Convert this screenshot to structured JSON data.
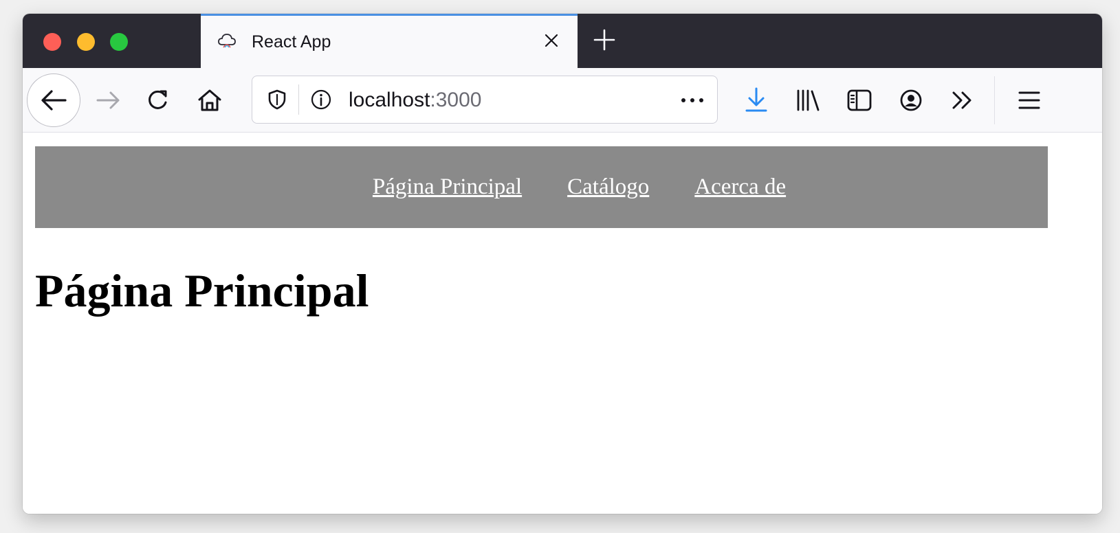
{
  "window": {
    "tab": {
      "title": "React App",
      "favicon": "rainbow-cloud-icon"
    },
    "colors": {
      "tab_accent": "#4a90e2",
      "tabstrip": "#2b2a33",
      "download_accent": "#2a8bf2"
    }
  },
  "toolbar": {
    "url": {
      "host": "localhost",
      "port": ":3000"
    },
    "icons": [
      "back-arrow-icon",
      "forward-arrow-icon",
      "reload-icon",
      "home-icon",
      "shield-icon",
      "info-icon",
      "more-dots-icon",
      "download-icon",
      "library-icon",
      "sidebar-icon",
      "account-icon",
      "overflow-chevrons-icon",
      "hamburger-menu-icon"
    ]
  },
  "page": {
    "nav": {
      "links": [
        {
          "label": "Página Principal"
        },
        {
          "label": "Catálogo"
        },
        {
          "label": "Acerca de"
        }
      ],
      "background": "#8a8a8a"
    },
    "heading": "Página Principal"
  }
}
